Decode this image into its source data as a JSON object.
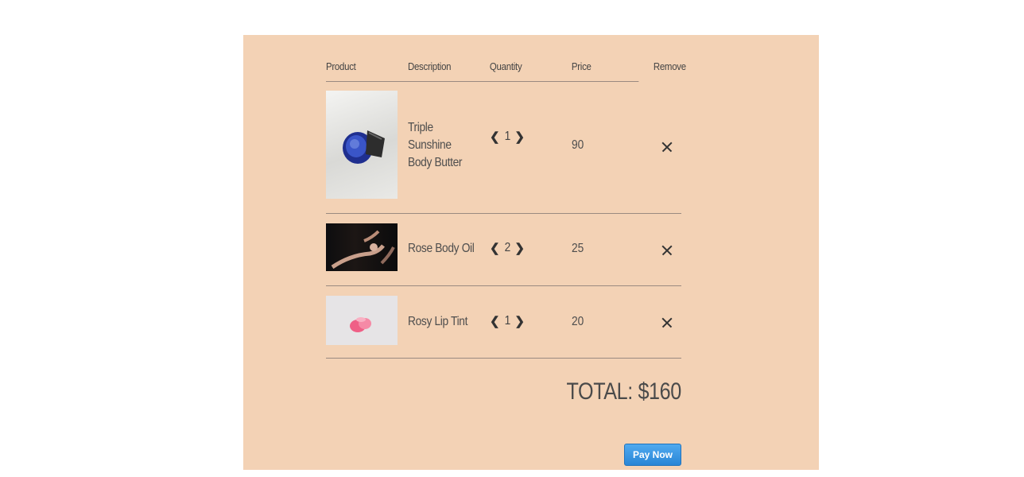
{
  "cart": {
    "headers": {
      "product": "Product",
      "description": "Description",
      "quantity": "Quantity",
      "price": "Price",
      "remove": "Remove"
    },
    "items": [
      {
        "description": "Triple Sunshine Body Butter",
        "quantity": "1",
        "price": "90",
        "image": "blue-jar-on-sand-image"
      },
      {
        "description": "Rose Body Oil",
        "quantity": "2",
        "price": "25",
        "image": "hands-dark-image"
      },
      {
        "description": "Rosy Lip Tint",
        "quantity": "1",
        "price": "20",
        "image": "pink-lip-tint-image"
      }
    ],
    "total": "TOTAL: $160",
    "pay_label": "Pay Now"
  },
  "colors": {
    "panel_bg": "#f3d2b5",
    "button_blue": "#2a86d6"
  }
}
